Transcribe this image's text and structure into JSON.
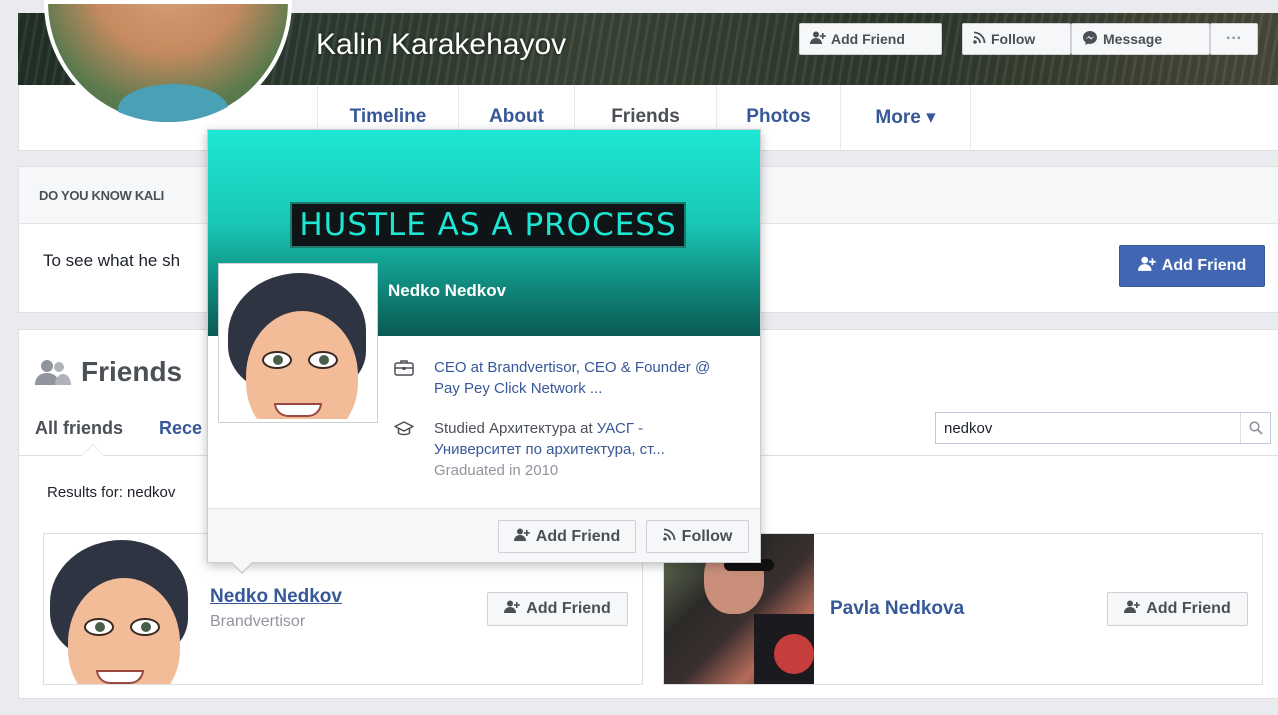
{
  "profile": {
    "name": "Kalin Karakehayov",
    "cover_buttons": {
      "add_friend": "Add Friend",
      "follow": "Follow",
      "message": "Message",
      "more": "···"
    }
  },
  "nav": {
    "tabs": [
      {
        "label": "Timeline"
      },
      {
        "label": "About"
      },
      {
        "label": "Friends"
      },
      {
        "label": "Photos"
      },
      {
        "label": "More ▾"
      }
    ],
    "active_tab": "Friends"
  },
  "do_you_know": {
    "heading": "DO YOU KNOW KALI",
    "text": "To see what he sh",
    "add_friend_label": "Add Friend"
  },
  "friends": {
    "title": "Friends",
    "tabs": [
      {
        "label": "All friends"
      },
      {
        "label": "Rece"
      }
    ],
    "search": {
      "value": "nedkov"
    },
    "results_text": "Results for: nedkov",
    "items": [
      {
        "name": "Nedko Nedkov",
        "subtitle": "Brandvertisor",
        "button": "Add Friend"
      },
      {
        "name": "Pavla Nedkova",
        "subtitle": "",
        "button": "Add Friend"
      }
    ]
  },
  "hovercard": {
    "banner": "HUSTLE AS A PROCESS",
    "name": "Nedko Nedkov",
    "work": {
      "prefix": "CEO at ",
      "company": "Brandvertisor",
      "rest": ", CEO & Founder @ Pay Pey Click Network ..."
    },
    "education": {
      "prefix": "Studied Архитектура at ",
      "school": "УАСГ - Университет по архитектура, ст...",
      "graduated": "Graduated in 2010"
    },
    "buttons": {
      "add_friend": "Add Friend",
      "follow": "Follow"
    }
  },
  "colors": {
    "link": "#365899",
    "primary_button": "#4267b2",
    "hover_cover_top": "#1de7d3"
  },
  "icons": [
    "add-friend-icon",
    "rss-follow-icon",
    "messenger-icon",
    "friends-icon",
    "search-icon",
    "briefcase-icon",
    "graduation-cap-icon"
  ]
}
